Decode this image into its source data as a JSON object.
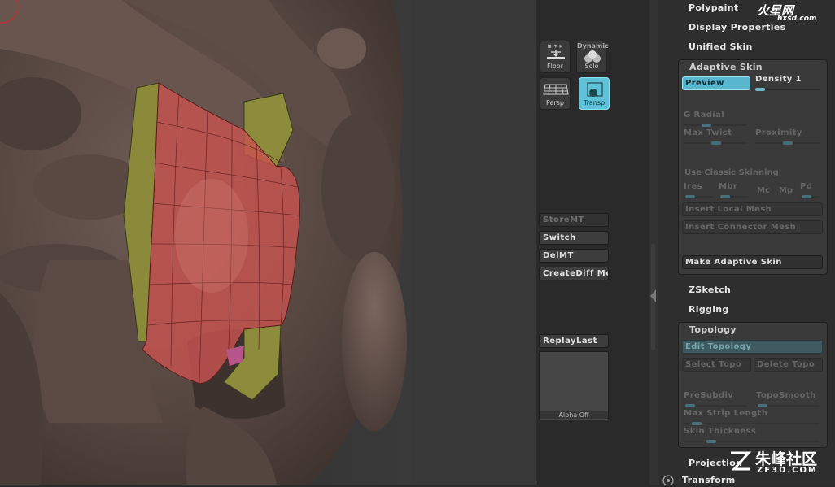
{
  "shelf": {
    "floor_top": "▪ ▾ ▸",
    "floor": "Floor",
    "dynamic": "Dynamic",
    "solo": "Solo",
    "persp": "Persp",
    "transp": "Transp",
    "buttons": [
      "StoreMT",
      "Switch",
      "DelMT",
      "CreateDiff Me"
    ],
    "replay": "ReplayLast",
    "alpha": "Alpha Off"
  },
  "menus": {
    "polypaint": "Polypaint",
    "display_properties": "Display Properties",
    "unified_skin": "Unified Skin",
    "zsketch": "ZSketch",
    "rigging": "Rigging",
    "projection": "Projection",
    "transform": "Transform"
  },
  "adaptive_skin": {
    "title": "Adaptive Skin",
    "preview": "Preview",
    "density": "Density 1",
    "g_radial": "G Radial",
    "max_twist": "Max Twist",
    "proximity": "Proximity",
    "use_classic": "Use Classic Skinning",
    "ires": "Ires",
    "mbr": "Mbr",
    "mc": "Mc",
    "mp": "Mp",
    "pd": "Pd",
    "insert_local": "Insert Local Mesh",
    "insert_connector": "Insert Connector Mesh",
    "make": "Make Adaptive Skin"
  },
  "topology": {
    "title": "Topology",
    "edit": "Edit Topology",
    "select": "Select Topo",
    "delete": "Delete Topo",
    "presubdiv": "PreSubdiv",
    "toposmooth": "TopoSmooth",
    "max_strip": "Max Strip Length",
    "skin_thickness": "Skin Thickness"
  },
  "watermarks": {
    "top_logo": "火星网",
    "top_url": "hxsd.com",
    "bottom_logo": "朱峰社区",
    "bottom_url": "ZF3D.COM"
  },
  "colors": {
    "accent": "#58b7cf",
    "clay": "#5a4a44",
    "topology_red": "#c7534f",
    "topology_olive": "#8a8a3a"
  }
}
